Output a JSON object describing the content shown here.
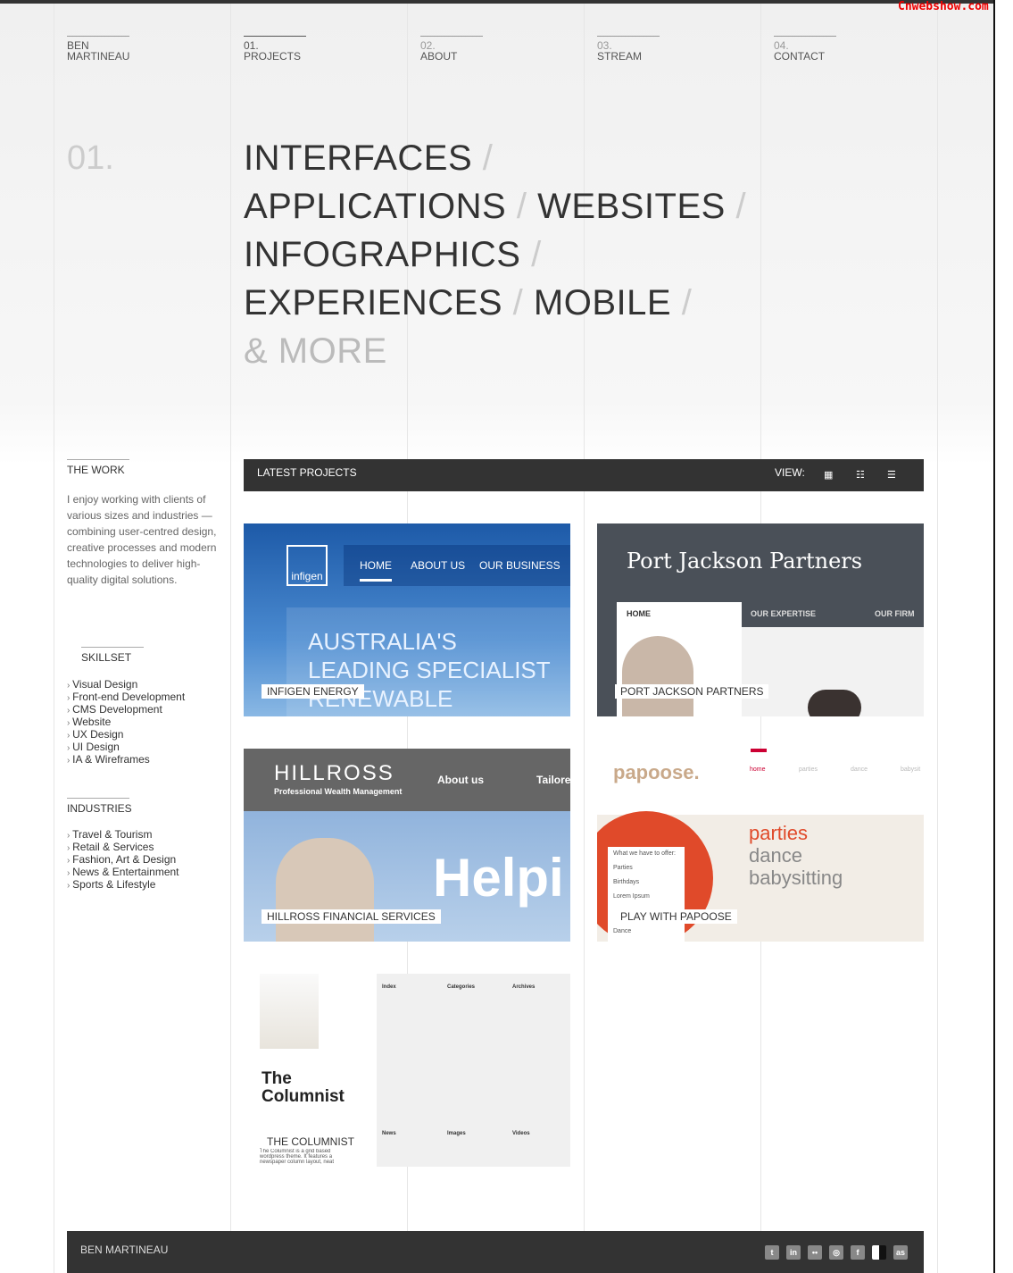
{
  "watermark": "Cnwebshow.com",
  "nav": [
    {
      "num": "BEN",
      "label": "MARTINEAU"
    },
    {
      "num": "01.",
      "label": "PROJECTS"
    },
    {
      "num": "02.",
      "label": "ABOUT"
    },
    {
      "num": "03.",
      "label": "STREAM"
    },
    {
      "num": "04.",
      "label": "CONTACT"
    }
  ],
  "hero": {
    "number": "01.",
    "lines": [
      [
        "INTERFACES"
      ],
      [
        "APPLICATIONS",
        "WEBSITES"
      ],
      [
        "INFOGRAPHICS"
      ],
      [
        "EXPERIENCES",
        "MOBILE"
      ]
    ],
    "sep": "/",
    "more": "& MORE"
  },
  "sidebar": {
    "work_title": "THE WORK",
    "work_text": "I enjoy working with clients of various sizes and industries — combining user-centred design, creative processes and modern technologies to deliver high-quality digital solutions.",
    "skill_title": "SKILLSET",
    "skills": [
      "Visual Design",
      "Front-end Development",
      "CMS Development",
      "Website",
      "UX Design",
      "UI Design",
      "IA & Wireframes"
    ],
    "ind_title": "INDUSTRIES",
    "industries": [
      "Travel & Tourism",
      "Retail & Services",
      "Fashion, Art & Design",
      "News & Entertainment",
      "Sports & Lifestyle"
    ]
  },
  "projects_bar": {
    "title": "LATEST PROJECTS",
    "view": "VIEW:",
    "view_icons": [
      "grid-icon",
      "thumb-list-icon",
      "list-icon"
    ]
  },
  "projects": [
    {
      "caption": "INFIGEN ENERGY",
      "logo": "infigen",
      "nav": [
        "HOME",
        "ABOUT US",
        "OUR BUSINESS"
      ],
      "text": [
        "AUSTRALIA'S",
        "LEADING SPECIALIST",
        "RENEWABLE"
      ]
    },
    {
      "caption": "PORT JACKSON PARTNERS",
      "title": "Port Jackson Partners",
      "nav": [
        "HOME",
        "OUR EXPERTISE",
        "OUR FIRM"
      ]
    },
    {
      "caption": "HILLROSS FINANCIAL SERVICES",
      "logo": "HILLROSS",
      "sub": "Professional Wealth Management",
      "nav": [
        "About us",
        "Tailore"
      ],
      "text": "Helpi"
    },
    {
      "caption": "PLAY WITH PAPOOSE",
      "logo": "papoose.",
      "nav": [
        "home",
        "parties",
        "dance",
        "babysit"
      ],
      "text": [
        "parties",
        "dance",
        "babysitting"
      ],
      "menu": [
        "What we have to offer:",
        "Parties",
        "Birthdays",
        "Lorem Ipsum",
        "Dance"
      ]
    },
    {
      "caption": "THE COLUMNIST",
      "title": "The Columnist",
      "cols": [
        "Index",
        "Categories",
        "Archives",
        "News",
        "Images",
        "Videos"
      ],
      "desc": "The Columnist is a grid based wordpress theme. It features a newspaper column layout, neat"
    }
  ],
  "footer": {
    "name": "BEN MARTINEAU",
    "social": [
      "twitter-icon",
      "linkedin-icon",
      "flickr-icon",
      "dribbble-icon",
      "facebook-icon",
      "delicious-icon",
      "lastfm-icon"
    ]
  },
  "colors": {
    "dark": "#333333",
    "infigen": "#2a6ab8",
    "pjp": "#4a5058",
    "papoose": "#e04a2a"
  }
}
